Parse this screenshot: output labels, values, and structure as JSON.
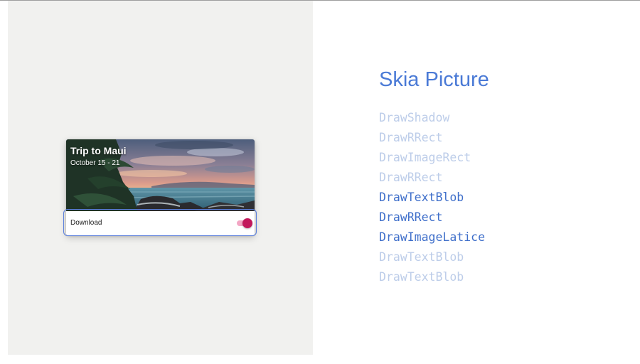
{
  "slide": {
    "heading": "Skia Picture",
    "accent_color": "#4a7ad6",
    "highlight_color": "#5b7fdc"
  },
  "card": {
    "title": "Trip to Maui",
    "subtitle": "October 15 - 21",
    "image": "tropical-beach-sunset-photo",
    "download_label": "Download",
    "download_enabled": true,
    "toggle_color": "#c2185b"
  },
  "draw_ops": [
    {
      "label": "DrawShadow",
      "active": false
    },
    {
      "label": "DrawRRect",
      "active": false
    },
    {
      "label": "DrawImageRect",
      "active": false
    },
    {
      "label": "DrawRRect",
      "active": false
    },
    {
      "label": "DrawTextBlob",
      "active": true
    },
    {
      "label": "DrawRRect",
      "active": true
    },
    {
      "label": "DrawImageLatice",
      "active": true
    },
    {
      "label": "DrawTextBlob",
      "active": false
    },
    {
      "label": "DrawTextBlob",
      "active": false
    }
  ]
}
